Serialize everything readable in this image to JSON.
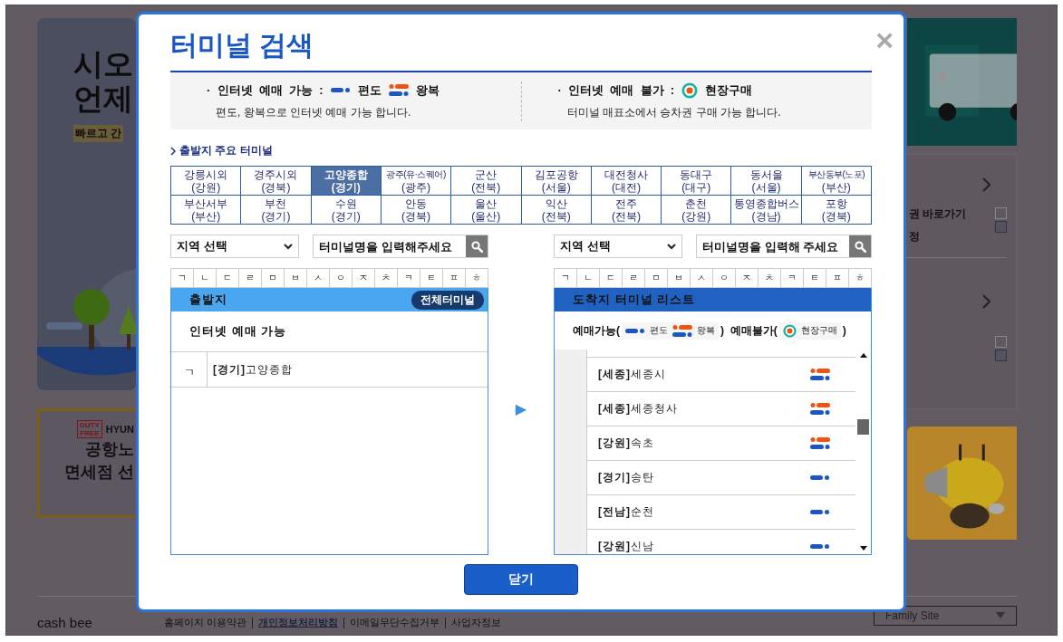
{
  "background": {
    "top_banner": {
      "lines": [
        "시오",
        "언제"
      ],
      "tagline": "빠르고 간"
    },
    "duty_free_banner": {
      "badge": "DUTY FREE",
      "brand": "HYUN",
      "lines": [
        "공항노",
        "면세점 선"
      ]
    },
    "side_panel": {
      "texts": [
        "권 바로가기",
        "정"
      ]
    },
    "footer": {
      "logo": "cash bee",
      "links": [
        {
          "label": "홈페이지 이용약관",
          "highlighted": false
        },
        {
          "label": "개인정보처리방침",
          "highlighted": true
        },
        {
          "label": "이메일무단수집거부",
          "highlighted": false
        },
        {
          "label": "사업자정보",
          "highlighted": false
        }
      ],
      "family_site": "Family Site"
    }
  },
  "modal": {
    "title": "터미널 검색",
    "close": "×",
    "legend": {
      "bookable": {
        "bullet": "·",
        "label": "인터넷  예매  가능  :",
        "one_way": "편도",
        "round_trip": "왕복",
        "note": "편도, 왕복으로 인터넷 예매 가능 합니다."
      },
      "not_bookable": {
        "bullet": "·",
        "label": "인터넷  예매  불가  :",
        "onsite": "현장구매",
        "note": "터미널 매표소에서 승차권 구매 가능 합니다."
      }
    },
    "section_heading": "출발지 주요 터미널",
    "major_terminals": [
      {
        "name": "강릉시외",
        "region": "(강원)",
        "selected": false
      },
      {
        "name": "경주시외",
        "region": "(경북)",
        "selected": false
      },
      {
        "name": "고양종합",
        "region": "(경기)",
        "selected": true
      },
      {
        "name": "광주(유·스퀘어)",
        "region": "(광주)",
        "selected": false
      },
      {
        "name": "군산",
        "region": "(전북)",
        "selected": false
      },
      {
        "name": "김포공항",
        "region": "(서울)",
        "selected": false
      },
      {
        "name": "대전청사",
        "region": "(대전)",
        "selected": false
      },
      {
        "name": "동대구",
        "region": "(대구)",
        "selected": false
      },
      {
        "name": "동서울",
        "region": "(서울)",
        "selected": false
      },
      {
        "name": "부산동부(노포)",
        "region": "(부산)",
        "selected": false
      },
      {
        "name": "부산서부",
        "region": "(부산)",
        "selected": false
      },
      {
        "name": "부천",
        "region": "(경기)",
        "selected": false
      },
      {
        "name": "수원",
        "region": "(경기)",
        "selected": false
      },
      {
        "name": "안동",
        "region": "(경북)",
        "selected": false
      },
      {
        "name": "울산",
        "region": "(울산)",
        "selected": false
      },
      {
        "name": "익산",
        "region": "(전북)",
        "selected": false
      },
      {
        "name": "전주",
        "region": "(전북)",
        "selected": false
      },
      {
        "name": "춘천",
        "region": "(강원)",
        "selected": false
      },
      {
        "name": "통영종합버스",
        "region": "(경남)",
        "selected": false
      },
      {
        "name": "포항",
        "region": "(경북)",
        "selected": false
      }
    ],
    "departure": {
      "region_select": "지역 선택",
      "search_placeholder": "터미널명을 입력해주세요",
      "consonants": [
        "ㄱ",
        "ㄴ",
        "ㄷ",
        "ㄹ",
        "ㅁ",
        "ㅂ",
        "ㅅ",
        "ㅇ",
        "ㅈ",
        "ㅊ",
        "ㅋ",
        "ㅌ",
        "ㅍ",
        "ㅎ"
      ],
      "header": "출발지",
      "all_button": "전체터미널",
      "subheader": "인터넷 예매 가능",
      "rows": [
        {
          "initial": "ㄱ",
          "terminal": "**[경기]**고양종합"
        }
      ]
    },
    "arrow": "▶",
    "arrival": {
      "region_select": "지역 선택",
      "search_placeholder": "터미널명을 입력해 주세요",
      "consonants": [
        "ㄱ",
        "ㄴ",
        "ㄷ",
        "ㄹ",
        "ㅁ",
        "ㅂ",
        "ㅅ",
        "ㅇ",
        "ㅈ",
        "ㅊ",
        "ㅋ",
        "ㅌ",
        "ㅍ",
        "ㅎ"
      ],
      "header": "도착지 터미널 리스트",
      "legend": {
        "bookable_open": "예매가능(",
        "one_way": "편도",
        "round_trip": "왕복",
        "middle": ")  예매불가(",
        "onsite": "현장구매",
        "close": ")"
      },
      "rows": [
        {
          "terminal": "**[세종]**세종시",
          "kind": "round"
        },
        {
          "terminal": "**[세종]**세종청사",
          "kind": "round"
        },
        {
          "terminal": "**[강원]**속초",
          "kind": "round"
        },
        {
          "terminal": "**[경기]**송탄",
          "kind": "oneway"
        },
        {
          "terminal": "**[전남]**순천",
          "kind": "oneway"
        },
        {
          "terminal": "**[강원]**신남",
          "kind": "oneway"
        }
      ]
    },
    "close_button": "닫기"
  }
}
